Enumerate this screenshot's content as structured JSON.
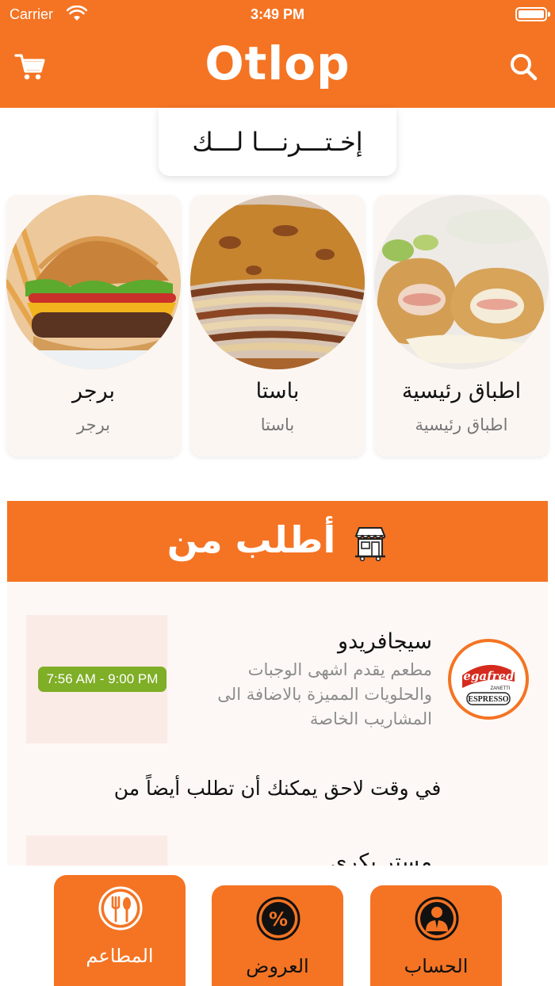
{
  "status_bar": {
    "carrier": "Carrier",
    "time": "3:49 PM"
  },
  "header": {
    "brand": "Otlop",
    "cart_icon": "cart-icon",
    "search_icon": "search-icon"
  },
  "picked": {
    "title": "إخـتـــرنـــا لـــك"
  },
  "categories": [
    {
      "title": "برجر",
      "subtitle": "برجر",
      "image": "burger-photo"
    },
    {
      "title": "باستا",
      "subtitle": "باستا",
      "image": "lasagna-photo"
    },
    {
      "title": "اطباق رئيسية",
      "subtitle": "اطباق رئيسية",
      "image": "cordon-bleu-photo"
    }
  ],
  "order_from": {
    "title": "أطلب من",
    "icon": "store-icon"
  },
  "restaurants": [
    {
      "name": "سيجافريدو",
      "description": "مطعم يقدم اشهى الوجبات والحلويات المميزة بالاضافة الى المشاريب الخاصة",
      "hours": "7:56 AM - 9:00 PM",
      "logo_text": "Segafredo",
      "logo_sub": "ZANETTI",
      "logo_bottom": "ESPRESSO"
    },
    {
      "name": "مستر بكري"
    }
  ],
  "later_text": "في وقت لاحق يمكنك أن تطلب أيضاً من",
  "tabs": [
    {
      "label": "المطاعم",
      "icon": "restaurant-cutlery-icon",
      "active": true
    },
    {
      "label": "العروض",
      "icon": "percent-icon",
      "active": false
    },
    {
      "label": "الحساب",
      "icon": "account-user-icon",
      "active": false
    }
  ],
  "colors": {
    "brand_orange": "#F47423",
    "hours_green": "#7fae27",
    "inactive_icon": "#111111",
    "active_label": "#ffffff"
  }
}
